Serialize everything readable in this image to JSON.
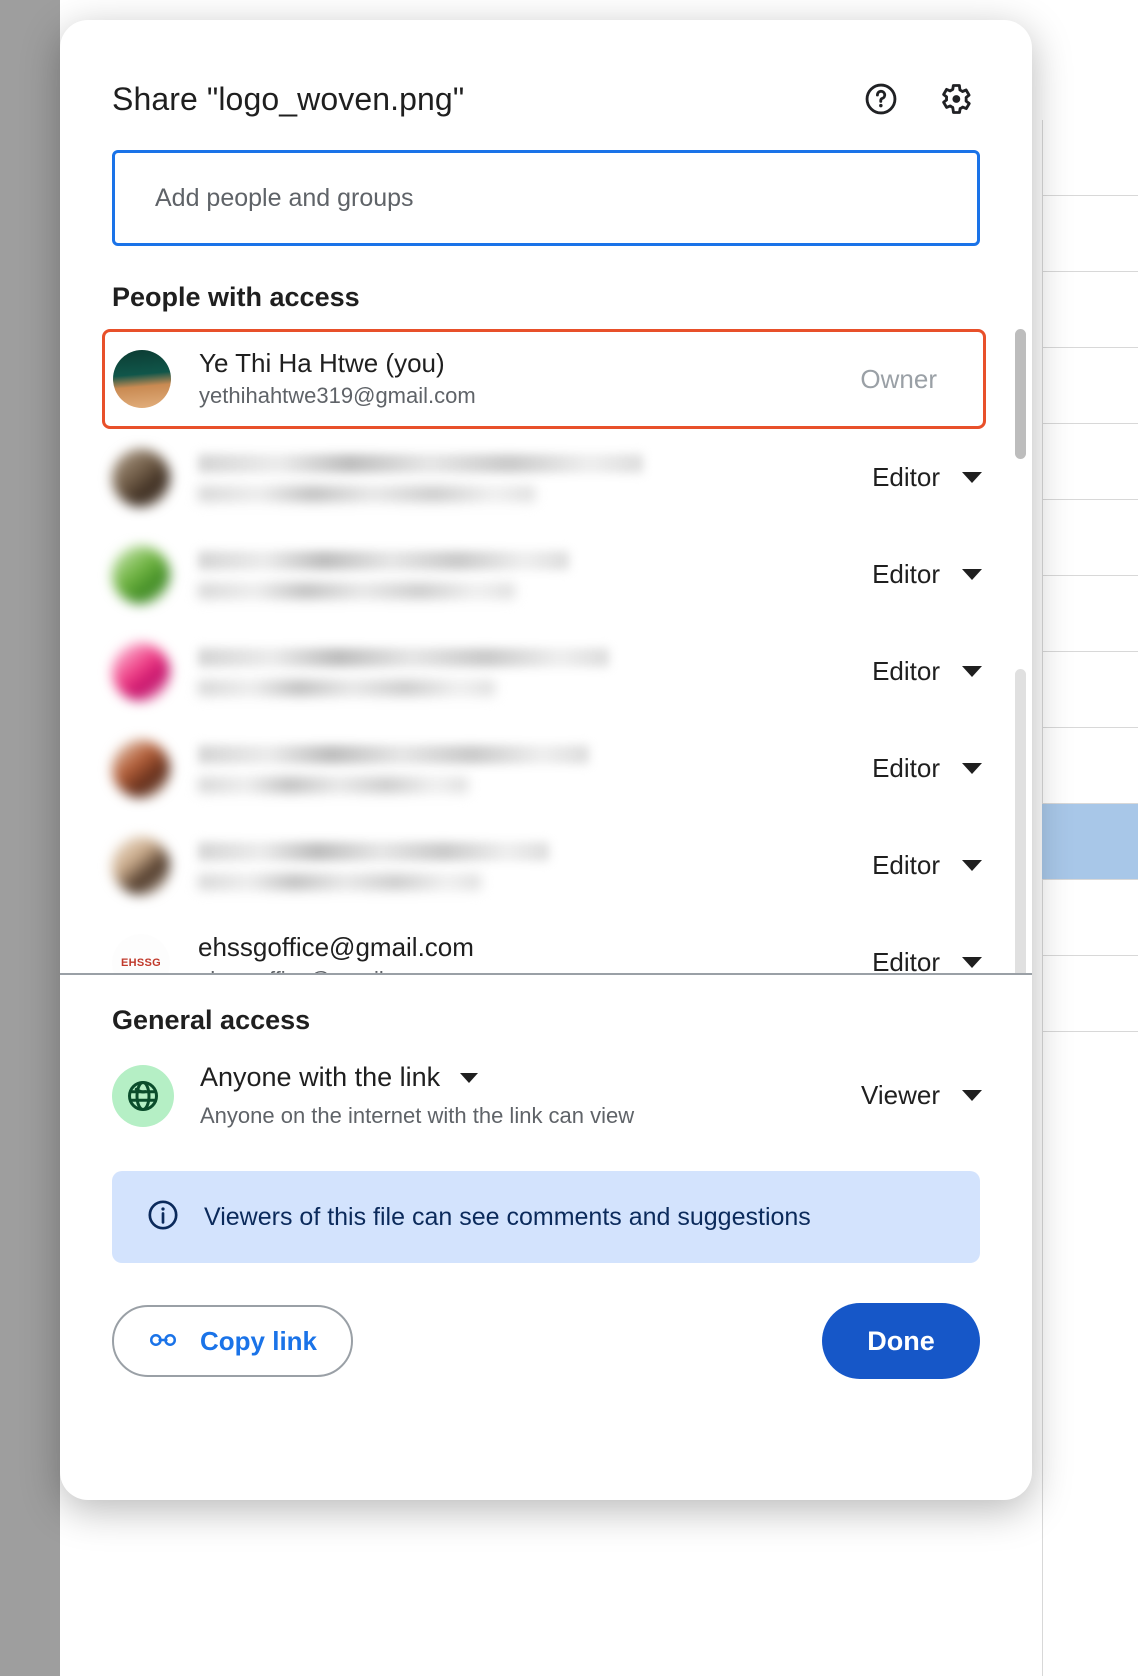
{
  "dialog": {
    "title": "Share \"logo_woven.png\"",
    "help_icon": "help-circle-icon",
    "settings_icon": "gear-icon"
  },
  "add_people": {
    "placeholder": "Add people and groups",
    "value": ""
  },
  "people_section": {
    "heading": "People with access",
    "rows": [
      {
        "name": "Ye Thi Ha Htwe (you)",
        "email": "yethihahtwe319@gmail.com",
        "role": "Owner",
        "role_is_dropdown": false,
        "redacted": false,
        "highlighted": true,
        "avatar_kind": "photo-landscape"
      },
      {
        "name": "",
        "email": "",
        "role": "Editor",
        "role_is_dropdown": true,
        "redacted": true,
        "highlighted": false,
        "avatar_kind": "photo-person-1"
      },
      {
        "name": "",
        "email": "",
        "role": "Editor",
        "role_is_dropdown": true,
        "redacted": true,
        "highlighted": false,
        "avatar_kind": "photo-green"
      },
      {
        "name": "",
        "email": "",
        "role": "Editor",
        "role_is_dropdown": true,
        "redacted": true,
        "highlighted": false,
        "avatar_kind": "photo-pink"
      },
      {
        "name": "",
        "email": "",
        "role": "Editor",
        "role_is_dropdown": true,
        "redacted": true,
        "highlighted": false,
        "avatar_kind": "photo-person-2"
      },
      {
        "name": "",
        "email": "",
        "role": "Editor",
        "role_is_dropdown": true,
        "redacted": true,
        "highlighted": false,
        "avatar_kind": "photo-person-3"
      },
      {
        "name": "ehssgoffice@gmail.com",
        "email": "ehssgoffice@gmail.com",
        "role": "Editor",
        "role_is_dropdown": true,
        "redacted": false,
        "highlighted": false,
        "avatar_kind": "logo-ehssg",
        "avatar_label": "EHSSG"
      }
    ]
  },
  "general_access": {
    "heading": "General access",
    "link_scope": "Anyone with the link",
    "description": "Anyone on the internet with the link can view",
    "role": "Viewer",
    "globe_icon": "globe-icon"
  },
  "info_banner": {
    "icon": "info-icon",
    "text": "Viewers of this file can see comments and suggestions"
  },
  "footer": {
    "copy_link_label": "Copy link",
    "copy_link_icon": "link-icon",
    "done_label": "Done"
  },
  "colors": {
    "accent_blue": "#1a73e8",
    "done_blue": "#1657c8",
    "highlight_orange": "#e8502a",
    "banner_blue": "#d3e3fd",
    "globe_green": "#b5efc5"
  }
}
